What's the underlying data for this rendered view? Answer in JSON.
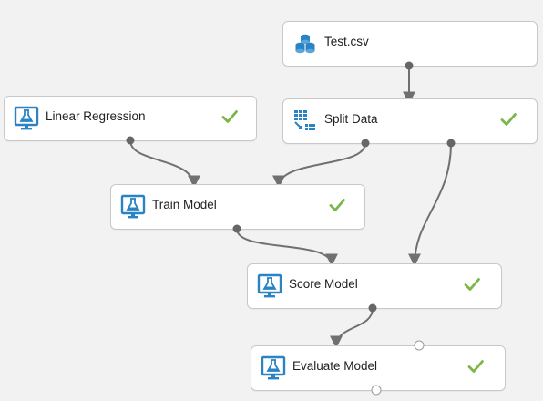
{
  "modules": [
    {
      "id": "test-csv",
      "label": "Test.csv",
      "icon": "dataset-icon",
      "status": ""
    },
    {
      "id": "linear-regression",
      "label": "Linear Regression",
      "icon": "flask-monitor-icon",
      "status": "completed"
    },
    {
      "id": "split-data",
      "label": "Split Data",
      "icon": "split-data-icon",
      "status": "completed"
    },
    {
      "id": "train-model",
      "label": "Train Model",
      "icon": "flask-monitor-icon",
      "status": "completed"
    },
    {
      "id": "score-model",
      "label": "Score Model",
      "icon": "flask-monitor-icon",
      "status": "completed"
    },
    {
      "id": "evaluate-model",
      "label": "Evaluate Model",
      "icon": "flask-monitor-icon",
      "status": "completed"
    }
  ],
  "colors": {
    "canvas": "#f2f2f2",
    "node_border": "#c8c8c8",
    "icon_blue": "#2a84c4",
    "check_green": "#7ab648",
    "connector": "#707070",
    "port": "#666666"
  }
}
